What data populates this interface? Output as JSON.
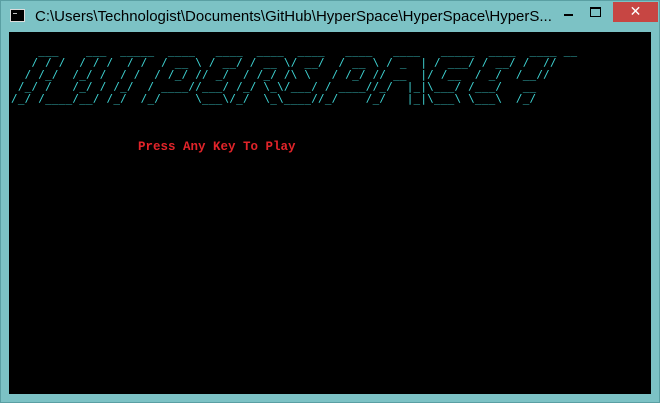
{
  "window": {
    "title": "C:\\Users\\Technologist\\Documents\\GitHub\\HyperSpace\\HyperSpace\\HyperS...",
    "close_glyph": "✕"
  },
  "console": {
    "logo_text": "HYPERSPACE!",
    "logo_color": "#3fd3d3",
    "prompt": "Press Any Key To Play",
    "prompt_color": "#e1242a"
  }
}
